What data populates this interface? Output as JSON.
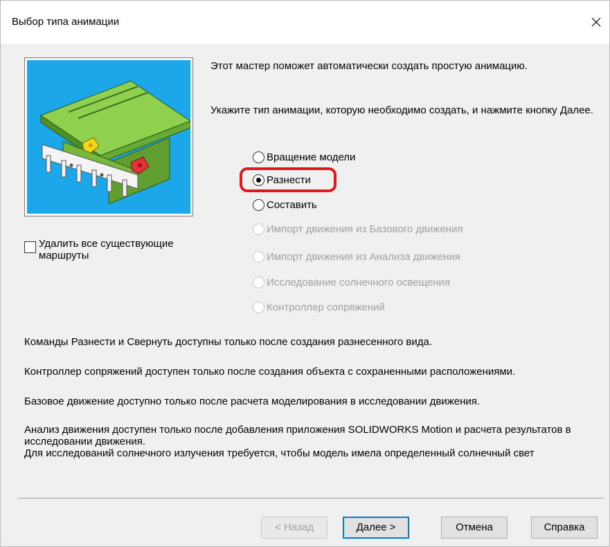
{
  "window": {
    "title": "Выбор типа анимации"
  },
  "options": {
    "delete_routes_label": "Удалить все существующие маршруты",
    "delete_routes_checked": false
  },
  "intro_text": "Этот мастер поможет автоматически создать простую анимацию.",
  "instruction_text": "Укажите тип анимации, которую необходимо создать, и нажмите кнопку Далее.",
  "animation_types": [
    {
      "label": "Вращение модели",
      "checked": false,
      "enabled": true
    },
    {
      "label": "Разнести",
      "checked": true,
      "enabled": true
    },
    {
      "label": "Составить",
      "checked": false,
      "enabled": true
    },
    {
      "label": "Импорт движения из Базового движения",
      "checked": false,
      "enabled": false
    },
    {
      "label": "Импорт движения из Анализа движения",
      "checked": false,
      "enabled": false
    },
    {
      "label": "Исследование солнечного освещения",
      "checked": false,
      "enabled": false
    },
    {
      "label": "Контроллер сопряжений",
      "checked": false,
      "enabled": false
    }
  ],
  "notes": [
    "Команды Разнести и Свернуть доступны только после создания разнесенного вида.",
    "Контроллер сопряжений доступен только после создания объекта с сохраненными расположениями.",
    "Базовое движение доступно только после расчета моделирования в исследовании движения.",
    "Анализ движения доступен только после добавления приложения SOLIDWORKS Motion и расчета результатов в исследовании движения.\nДля исследований солнечного излучения требуется, чтобы модель имела определенный солнечный свет"
  ],
  "buttons": {
    "back": "< Назад",
    "next": "Далее >",
    "cancel": "Отмена",
    "help": "Справка"
  },
  "colors": {
    "preview_bg": "#1ca7ea",
    "highlight": "#e0191e",
    "default_button_border": "#0078d7"
  }
}
